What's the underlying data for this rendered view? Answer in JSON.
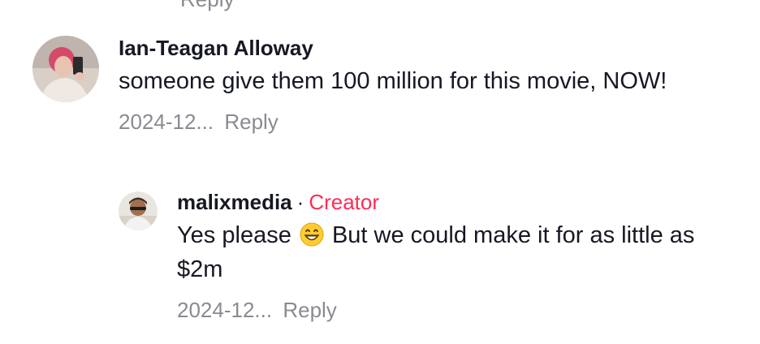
{
  "cut_text": "Reply",
  "comment": {
    "author": "Ian-Teagan Alloway",
    "text": "someone give them 100 million for this movie, NOW!",
    "date": "2024-12...",
    "reply_label": "Reply",
    "avatar_icon": "user-photo-avatar"
  },
  "reply": {
    "author": "malixmedia",
    "separator": "·",
    "badge": "Creator",
    "text_before_emoji": "Yes please ",
    "emoji": "grinning-face-emoji",
    "text_after_emoji": " But we could make it for as little as $2m",
    "date": "2024-12...",
    "reply_label": "Reply",
    "avatar_icon": "user-photo-avatar",
    "badge_color": "#fe2c55"
  }
}
